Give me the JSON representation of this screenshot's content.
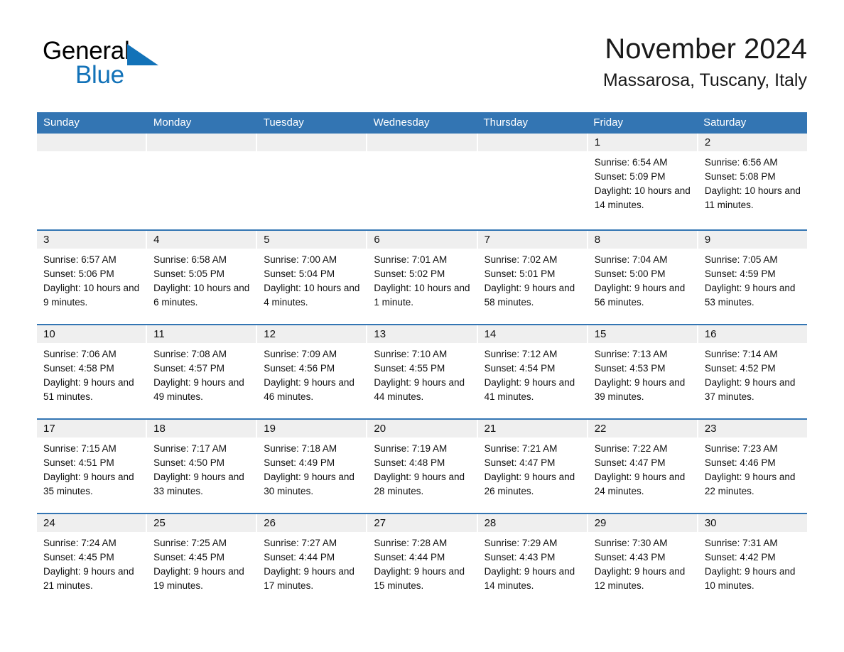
{
  "brand": {
    "name_part1": "General",
    "name_part2": "Blue",
    "triangle_color": "#1272b8",
    "text_color": "#000000"
  },
  "header": {
    "title": "November 2024",
    "subtitle": "Massarosa, Tuscany, Italy"
  },
  "theme": {
    "header_blue": "#3375b3",
    "day_band_gray": "#efefef",
    "rule_blue": "#3375b3",
    "text_color": "#111111"
  },
  "weekdays": [
    "Sunday",
    "Monday",
    "Tuesday",
    "Wednesday",
    "Thursday",
    "Friday",
    "Saturday"
  ],
  "labels": {
    "sunrise_prefix": "Sunrise:",
    "sunset_prefix": "Sunset:",
    "daylight_prefix": "Daylight:"
  },
  "weeks": [
    [
      {
        "day": "",
        "empty": true
      },
      {
        "day": "",
        "empty": true
      },
      {
        "day": "",
        "empty": true
      },
      {
        "day": "",
        "empty": true
      },
      {
        "day": "",
        "empty": true
      },
      {
        "day": "1",
        "sunrise": "Sunrise: 6:54 AM",
        "sunset": "Sunset: 5:09 PM",
        "daylight": "Daylight: 10 hours and 14 minutes."
      },
      {
        "day": "2",
        "sunrise": "Sunrise: 6:56 AM",
        "sunset": "Sunset: 5:08 PM",
        "daylight": "Daylight: 10 hours and 11 minutes."
      }
    ],
    [
      {
        "day": "3",
        "sunrise": "Sunrise: 6:57 AM",
        "sunset": "Sunset: 5:06 PM",
        "daylight": "Daylight: 10 hours and 9 minutes."
      },
      {
        "day": "4",
        "sunrise": "Sunrise: 6:58 AM",
        "sunset": "Sunset: 5:05 PM",
        "daylight": "Daylight: 10 hours and 6 minutes."
      },
      {
        "day": "5",
        "sunrise": "Sunrise: 7:00 AM",
        "sunset": "Sunset: 5:04 PM",
        "daylight": "Daylight: 10 hours and 4 minutes."
      },
      {
        "day": "6",
        "sunrise": "Sunrise: 7:01 AM",
        "sunset": "Sunset: 5:02 PM",
        "daylight": "Daylight: 10 hours and 1 minute."
      },
      {
        "day": "7",
        "sunrise": "Sunrise: 7:02 AM",
        "sunset": "Sunset: 5:01 PM",
        "daylight": "Daylight: 9 hours and 58 minutes."
      },
      {
        "day": "8",
        "sunrise": "Sunrise: 7:04 AM",
        "sunset": "Sunset: 5:00 PM",
        "daylight": "Daylight: 9 hours and 56 minutes."
      },
      {
        "day": "9",
        "sunrise": "Sunrise: 7:05 AM",
        "sunset": "Sunset: 4:59 PM",
        "daylight": "Daylight: 9 hours and 53 minutes."
      }
    ],
    [
      {
        "day": "10",
        "sunrise": "Sunrise: 7:06 AM",
        "sunset": "Sunset: 4:58 PM",
        "daylight": "Daylight: 9 hours and 51 minutes."
      },
      {
        "day": "11",
        "sunrise": "Sunrise: 7:08 AM",
        "sunset": "Sunset: 4:57 PM",
        "daylight": "Daylight: 9 hours and 49 minutes."
      },
      {
        "day": "12",
        "sunrise": "Sunrise: 7:09 AM",
        "sunset": "Sunset: 4:56 PM",
        "daylight": "Daylight: 9 hours and 46 minutes."
      },
      {
        "day": "13",
        "sunrise": "Sunrise: 7:10 AM",
        "sunset": "Sunset: 4:55 PM",
        "daylight": "Daylight: 9 hours and 44 minutes."
      },
      {
        "day": "14",
        "sunrise": "Sunrise: 7:12 AM",
        "sunset": "Sunset: 4:54 PM",
        "daylight": "Daylight: 9 hours and 41 minutes."
      },
      {
        "day": "15",
        "sunrise": "Sunrise: 7:13 AM",
        "sunset": "Sunset: 4:53 PM",
        "daylight": "Daylight: 9 hours and 39 minutes."
      },
      {
        "day": "16",
        "sunrise": "Sunrise: 7:14 AM",
        "sunset": "Sunset: 4:52 PM",
        "daylight": "Daylight: 9 hours and 37 minutes."
      }
    ],
    [
      {
        "day": "17",
        "sunrise": "Sunrise: 7:15 AM",
        "sunset": "Sunset: 4:51 PM",
        "daylight": "Daylight: 9 hours and 35 minutes."
      },
      {
        "day": "18",
        "sunrise": "Sunrise: 7:17 AM",
        "sunset": "Sunset: 4:50 PM",
        "daylight": "Daylight: 9 hours and 33 minutes."
      },
      {
        "day": "19",
        "sunrise": "Sunrise: 7:18 AM",
        "sunset": "Sunset: 4:49 PM",
        "daylight": "Daylight: 9 hours and 30 minutes."
      },
      {
        "day": "20",
        "sunrise": "Sunrise: 7:19 AM",
        "sunset": "Sunset: 4:48 PM",
        "daylight": "Daylight: 9 hours and 28 minutes."
      },
      {
        "day": "21",
        "sunrise": "Sunrise: 7:21 AM",
        "sunset": "Sunset: 4:47 PM",
        "daylight": "Daylight: 9 hours and 26 minutes."
      },
      {
        "day": "22",
        "sunrise": "Sunrise: 7:22 AM",
        "sunset": "Sunset: 4:47 PM",
        "daylight": "Daylight: 9 hours and 24 minutes."
      },
      {
        "day": "23",
        "sunrise": "Sunrise: 7:23 AM",
        "sunset": "Sunset: 4:46 PM",
        "daylight": "Daylight: 9 hours and 22 minutes."
      }
    ],
    [
      {
        "day": "24",
        "sunrise": "Sunrise: 7:24 AM",
        "sunset": "Sunset: 4:45 PM",
        "daylight": "Daylight: 9 hours and 21 minutes."
      },
      {
        "day": "25",
        "sunrise": "Sunrise: 7:25 AM",
        "sunset": "Sunset: 4:45 PM",
        "daylight": "Daylight: 9 hours and 19 minutes."
      },
      {
        "day": "26",
        "sunrise": "Sunrise: 7:27 AM",
        "sunset": "Sunset: 4:44 PM",
        "daylight": "Daylight: 9 hours and 17 minutes."
      },
      {
        "day": "27",
        "sunrise": "Sunrise: 7:28 AM",
        "sunset": "Sunset: 4:44 PM",
        "daylight": "Daylight: 9 hours and 15 minutes."
      },
      {
        "day": "28",
        "sunrise": "Sunrise: 7:29 AM",
        "sunset": "Sunset: 4:43 PM",
        "daylight": "Daylight: 9 hours and 14 minutes."
      },
      {
        "day": "29",
        "sunrise": "Sunrise: 7:30 AM",
        "sunset": "Sunset: 4:43 PM",
        "daylight": "Daylight: 9 hours and 12 minutes."
      },
      {
        "day": "30",
        "sunrise": "Sunrise: 7:31 AM",
        "sunset": "Sunset: 4:42 PM",
        "daylight": "Daylight: 9 hours and 10 minutes."
      }
    ]
  ]
}
